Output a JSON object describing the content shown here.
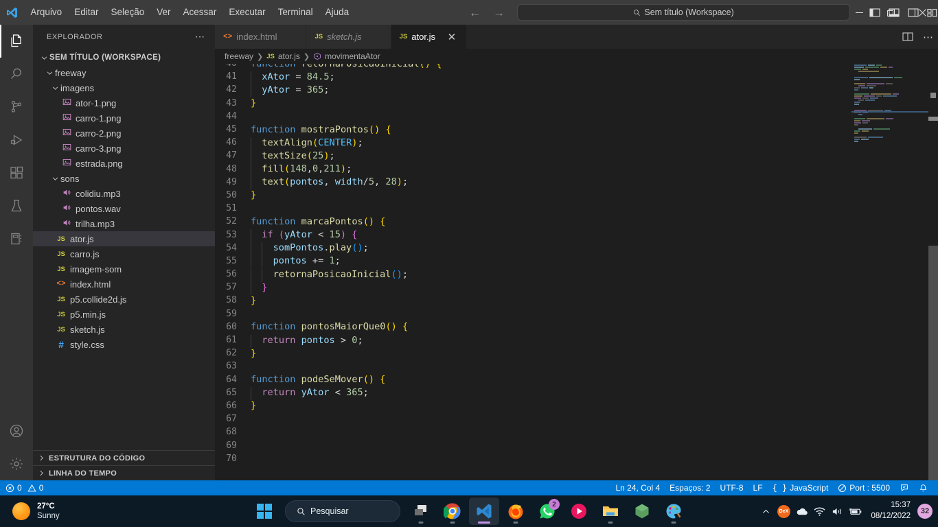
{
  "titlebar": {
    "menu": [
      "Arquivo",
      "Editar",
      "Seleção",
      "Ver",
      "Acessar",
      "Executar",
      "Terminal",
      "Ajuda"
    ],
    "command_center_text": "Sem título (Workspace)",
    "back_icon": "arrow-left-icon",
    "forward_icon": "arrow-right-icon",
    "layout_icons": [
      "toggle-primary-sidebar-icon",
      "toggle-panel-icon",
      "toggle-secondary-sidebar-icon",
      "customize-layout-icon"
    ],
    "window_controls": [
      "minimize",
      "restore",
      "close"
    ]
  },
  "activitybar": {
    "items": [
      {
        "name": "explorer",
        "icon": "files-icon",
        "active": true
      },
      {
        "name": "search",
        "icon": "search-icon",
        "active": false
      },
      {
        "name": "source-control",
        "icon": "source-control-icon",
        "active": false
      },
      {
        "name": "run-and-debug",
        "icon": "run-debug-icon",
        "active": false
      },
      {
        "name": "extensions",
        "icon": "extensions-icon",
        "active": false
      },
      {
        "name": "testing",
        "icon": "beaker-icon",
        "active": false
      },
      {
        "name": "notebook",
        "icon": "notebook-icon",
        "active": false
      }
    ],
    "bottom": [
      {
        "name": "accounts",
        "icon": "account-icon"
      },
      {
        "name": "manage",
        "icon": "gear-icon"
      }
    ]
  },
  "sidebar": {
    "title": "EXPLORADOR",
    "more_actions_icon": "ellipsis-icon",
    "tree": [
      {
        "label": "SEM TÍTULO (WORKSPACE)",
        "indent": 0,
        "type": "root",
        "expanded": true
      },
      {
        "label": "freeway",
        "indent": 1,
        "type": "folder",
        "expanded": true
      },
      {
        "label": "imagens",
        "indent": 2,
        "type": "folder",
        "expanded": true
      },
      {
        "label": "ator-1.png",
        "indent": 3,
        "type": "image"
      },
      {
        "label": "carro-1.png",
        "indent": 3,
        "type": "image"
      },
      {
        "label": "carro-2.png",
        "indent": 3,
        "type": "image"
      },
      {
        "label": "carro-3.png",
        "indent": 3,
        "type": "image"
      },
      {
        "label": "estrada.png",
        "indent": 3,
        "type": "image"
      },
      {
        "label": "sons",
        "indent": 2,
        "type": "folder",
        "expanded": true
      },
      {
        "label": "colidiu.mp3",
        "indent": 3,
        "type": "audio"
      },
      {
        "label": "pontos.wav",
        "indent": 3,
        "type": "audio"
      },
      {
        "label": "trilha.mp3",
        "indent": 3,
        "type": "audio"
      },
      {
        "label": "ator.js",
        "indent": 2,
        "type": "js",
        "selected": true
      },
      {
        "label": "carro.js",
        "indent": 2,
        "type": "js"
      },
      {
        "label": "imagem-som",
        "indent": 2,
        "type": "js"
      },
      {
        "label": "index.html",
        "indent": 2,
        "type": "html"
      },
      {
        "label": "p5.collide2d.js",
        "indent": 2,
        "type": "js"
      },
      {
        "label": "p5.min.js",
        "indent": 2,
        "type": "js"
      },
      {
        "label": "sketch.js",
        "indent": 2,
        "type": "js"
      },
      {
        "label": "style.css",
        "indent": 2,
        "type": "css"
      }
    ],
    "panels": [
      {
        "label": "ESTRUTURA DO CÓDIGO",
        "expanded": false
      },
      {
        "label": "LINHA DO TEMPO",
        "expanded": false
      }
    ]
  },
  "editor": {
    "tabs": [
      {
        "label": "index.html",
        "icon": "html-file-icon",
        "active": false,
        "preview": false
      },
      {
        "label": "sketch.js",
        "icon": "js-file-icon",
        "active": false,
        "preview": true
      },
      {
        "label": "ator.js",
        "icon": "js-file-icon",
        "active": true,
        "preview": false
      }
    ],
    "tab_close_icon": "close-icon",
    "actions": [
      "split-editor-icon",
      "more-actions-icon"
    ],
    "breadcrumb": [
      "freeway",
      "ator.js",
      "movimentaAtor"
    ],
    "breadcrumb_symbol_icon": "symbol-method-icon",
    "first_visible_line": 40,
    "lines": [
      {
        "n": 40,
        "clipped": true,
        "tokens": [
          {
            "t": "function ",
            "c": "kw"
          },
          {
            "t": "retornaPosicaoInicial",
            "c": "fn"
          },
          {
            "t": "(",
            "c": "par1"
          },
          {
            "t": ")",
            "c": "par1"
          },
          {
            "t": " ",
            "c": "pun"
          },
          {
            "t": "{",
            "c": "par1"
          }
        ]
      },
      {
        "n": 41,
        "indent": 1,
        "tokens": [
          {
            "t": "xAtor",
            "c": "var"
          },
          {
            "t": " = ",
            "c": "op"
          },
          {
            "t": "84.5",
            "c": "num"
          },
          {
            "t": ";",
            "c": "pun"
          }
        ]
      },
      {
        "n": 42,
        "indent": 1,
        "tokens": [
          {
            "t": "yAtor",
            "c": "var"
          },
          {
            "t": " = ",
            "c": "op"
          },
          {
            "t": "365",
            "c": "num"
          },
          {
            "t": ";",
            "c": "pun"
          }
        ]
      },
      {
        "n": 43,
        "tokens": [
          {
            "t": "}",
            "c": "par1"
          }
        ]
      },
      {
        "n": 44,
        "tokens": []
      },
      {
        "n": 45,
        "tokens": [
          {
            "t": "function ",
            "c": "kw"
          },
          {
            "t": "mostraPontos",
            "c": "fn"
          },
          {
            "t": "(",
            "c": "par1"
          },
          {
            "t": ")",
            "c": "par1"
          },
          {
            "t": " ",
            "c": "pun"
          },
          {
            "t": "{",
            "c": "par1"
          }
        ]
      },
      {
        "n": 46,
        "indent": 1,
        "tokens": [
          {
            "t": "textAlign",
            "c": "fn"
          },
          {
            "t": "(",
            "c": "par1"
          },
          {
            "t": "CENTER",
            "c": "cst"
          },
          {
            "t": ")",
            "c": "par1"
          },
          {
            "t": ";",
            "c": "pun"
          }
        ]
      },
      {
        "n": 47,
        "indent": 1,
        "tokens": [
          {
            "t": "textSize",
            "c": "fn"
          },
          {
            "t": "(",
            "c": "par1"
          },
          {
            "t": "25",
            "c": "num"
          },
          {
            "t": ")",
            "c": "par1"
          },
          {
            "t": ";",
            "c": "pun"
          }
        ]
      },
      {
        "n": 48,
        "indent": 1,
        "tokens": [
          {
            "t": "fill",
            "c": "fn"
          },
          {
            "t": "(",
            "c": "par1"
          },
          {
            "t": "148",
            "c": "num"
          },
          {
            "t": ",",
            "c": "pun"
          },
          {
            "t": "0",
            "c": "num"
          },
          {
            "t": ",",
            "c": "pun"
          },
          {
            "t": "211",
            "c": "num"
          },
          {
            "t": ")",
            "c": "par1"
          },
          {
            "t": ";",
            "c": "pun"
          }
        ]
      },
      {
        "n": 49,
        "indent": 1,
        "tokens": [
          {
            "t": "text",
            "c": "fn"
          },
          {
            "t": "(",
            "c": "par1"
          },
          {
            "t": "pontos",
            "c": "var"
          },
          {
            "t": ", ",
            "c": "pun"
          },
          {
            "t": "width",
            "c": "var"
          },
          {
            "t": "/",
            "c": "op"
          },
          {
            "t": "5",
            "c": "num"
          },
          {
            "t": ", ",
            "c": "pun"
          },
          {
            "t": "28",
            "c": "num"
          },
          {
            "t": ")",
            "c": "par1"
          },
          {
            "t": ";",
            "c": "pun"
          }
        ]
      },
      {
        "n": 50,
        "tokens": [
          {
            "t": "}",
            "c": "par1"
          }
        ]
      },
      {
        "n": 51,
        "tokens": []
      },
      {
        "n": 52,
        "tokens": [
          {
            "t": "function ",
            "c": "kw"
          },
          {
            "t": "marcaPontos",
            "c": "fn"
          },
          {
            "t": "(",
            "c": "par1"
          },
          {
            "t": ")",
            "c": "par1"
          },
          {
            "t": " ",
            "c": "pun"
          },
          {
            "t": "{",
            "c": "par1"
          }
        ]
      },
      {
        "n": 53,
        "indent": 1,
        "tokens": [
          {
            "t": "if",
            "c": "kwp"
          },
          {
            "t": " ",
            "c": "pun"
          },
          {
            "t": "(",
            "c": "par2"
          },
          {
            "t": "yAtor",
            "c": "var"
          },
          {
            "t": " < ",
            "c": "op"
          },
          {
            "t": "15",
            "c": "num"
          },
          {
            "t": ")",
            "c": "par2"
          },
          {
            "t": " ",
            "c": "pun"
          },
          {
            "t": "{",
            "c": "par2"
          }
        ]
      },
      {
        "n": 54,
        "indent": 2,
        "tokens": [
          {
            "t": "somPontos",
            "c": "var"
          },
          {
            "t": ".",
            "c": "pun"
          },
          {
            "t": "play",
            "c": "fn"
          },
          {
            "t": "(",
            "c": "par3"
          },
          {
            "t": ")",
            "c": "par3"
          },
          {
            "t": ";",
            "c": "pun"
          }
        ]
      },
      {
        "n": 55,
        "indent": 2,
        "tokens": [
          {
            "t": "pontos",
            "c": "var"
          },
          {
            "t": " += ",
            "c": "op"
          },
          {
            "t": "1",
            "c": "num"
          },
          {
            "t": ";",
            "c": "pun"
          }
        ]
      },
      {
        "n": 56,
        "indent": 2,
        "tokens": [
          {
            "t": "retornaPosicaoInicial",
            "c": "fn"
          },
          {
            "t": "(",
            "c": "par3"
          },
          {
            "t": ")",
            "c": "par3"
          },
          {
            "t": ";",
            "c": "pun"
          }
        ]
      },
      {
        "n": 57,
        "indent": 1,
        "tokens": [
          {
            "t": "}",
            "c": "par2"
          }
        ]
      },
      {
        "n": 58,
        "tokens": [
          {
            "t": "}",
            "c": "par1"
          }
        ]
      },
      {
        "n": 59,
        "tokens": []
      },
      {
        "n": 60,
        "tokens": [
          {
            "t": "function ",
            "c": "kw"
          },
          {
            "t": "pontosMaiorQue0",
            "c": "fn"
          },
          {
            "t": "(",
            "c": "par1"
          },
          {
            "t": ")",
            "c": "par1"
          },
          {
            "t": " ",
            "c": "pun"
          },
          {
            "t": "{",
            "c": "par1"
          }
        ]
      },
      {
        "n": 61,
        "indent": 1,
        "tokens": [
          {
            "t": "return",
            "c": "kwp"
          },
          {
            "t": " ",
            "c": "pun"
          },
          {
            "t": "pontos",
            "c": "var"
          },
          {
            "t": " > ",
            "c": "op"
          },
          {
            "t": "0",
            "c": "num"
          },
          {
            "t": ";",
            "c": "pun"
          }
        ]
      },
      {
        "n": 62,
        "tokens": [
          {
            "t": "}",
            "c": "par1"
          }
        ]
      },
      {
        "n": 63,
        "tokens": []
      },
      {
        "n": 64,
        "tokens": [
          {
            "t": "function ",
            "c": "kw"
          },
          {
            "t": "podeSeMover",
            "c": "fn"
          },
          {
            "t": "(",
            "c": "par1"
          },
          {
            "t": ")",
            "c": "par1"
          },
          {
            "t": " ",
            "c": "pun"
          },
          {
            "t": "{",
            "c": "par1"
          }
        ]
      },
      {
        "n": 65,
        "indent": 1,
        "tokens": [
          {
            "t": "return",
            "c": "kwp"
          },
          {
            "t": " ",
            "c": "pun"
          },
          {
            "t": "yAtor",
            "c": "var"
          },
          {
            "t": " < ",
            "c": "op"
          },
          {
            "t": "365",
            "c": "num"
          },
          {
            "t": ";",
            "c": "pun"
          }
        ]
      },
      {
        "n": 66,
        "tokens": [
          {
            "t": "}",
            "c": "par1"
          }
        ]
      },
      {
        "n": 67,
        "tokens": []
      },
      {
        "n": 68,
        "tokens": []
      },
      {
        "n": 69,
        "tokens": []
      },
      {
        "n": 70,
        "tokens": []
      }
    ]
  },
  "statusbar": {
    "errors_icon": "error-icon",
    "errors": "0",
    "warnings_icon": "warning-icon",
    "warnings": "0",
    "right_items": [
      {
        "label": "Ln 24, Col 4",
        "icon": null
      },
      {
        "label": "Espaços: 2",
        "icon": null
      },
      {
        "label": "UTF-8",
        "icon": null
      },
      {
        "label": "LF",
        "icon": null
      },
      {
        "label": "JavaScript",
        "icon": "braces-icon"
      },
      {
        "label": "Port : 5500",
        "icon": "circle-slash-icon"
      },
      {
        "label": "",
        "icon": "feedback-icon"
      },
      {
        "label": "",
        "icon": "bell-icon"
      }
    ],
    "accent_color": "#0078d4"
  },
  "taskbar": {
    "weather": {
      "temp": "27°C",
      "condition": "Sunny",
      "icon": "sun-icon"
    },
    "start_icon": "windows-start-icon",
    "search": {
      "label": "Pesquisar",
      "icon": "search-icon"
    },
    "items": [
      {
        "name": "task-view",
        "icon": "task-view-icon",
        "running": true,
        "active": false
      },
      {
        "name": "google-chrome",
        "icon": "chrome-icon",
        "running": true,
        "active": false
      },
      {
        "name": "visual-studio-code",
        "icon": "vscode-icon",
        "running": true,
        "active": true
      },
      {
        "name": "firefox",
        "icon": "firefox-icon",
        "running": true,
        "active": false
      },
      {
        "name": "whatsapp",
        "icon": "whatsapp-icon",
        "running": false,
        "active": false,
        "badge": "2"
      },
      {
        "name": "media-player",
        "icon": "media-player-icon",
        "running": false,
        "active": false
      },
      {
        "name": "file-explorer",
        "icon": "folder-icon",
        "running": true,
        "active": false
      },
      {
        "name": "green-app",
        "icon": "hexagon-icon",
        "running": false,
        "active": false
      },
      {
        "name": "paint",
        "icon": "paint-icon",
        "running": true,
        "active": false
      }
    ],
    "tray": {
      "chevron_icon": "chevron-up-icon",
      "icons": [
        "dex-icon",
        "onedrive-icon",
        "wifi-icon",
        "volume-icon",
        "battery-charging-icon"
      ],
      "dex_label": "DeX",
      "time": "15:37",
      "date": "08/12/2022",
      "notification_count": "32"
    }
  }
}
